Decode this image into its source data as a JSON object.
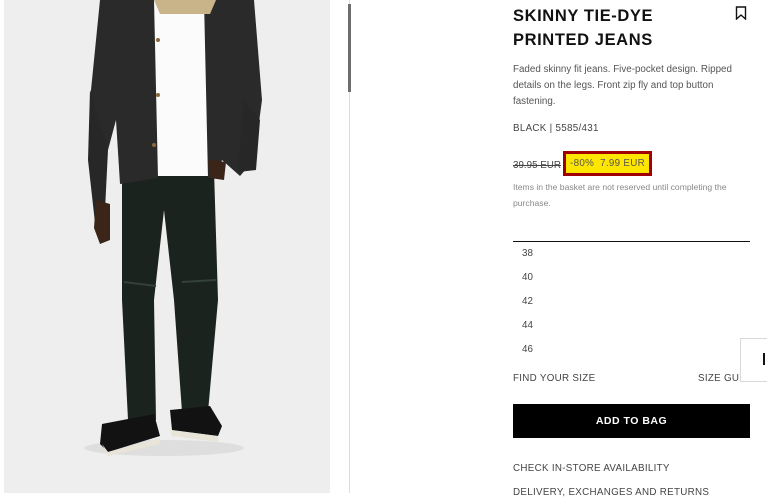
{
  "product": {
    "title": "SKINNY TIE-DYE PRINTED JEANS",
    "description": "Faded skinny fit jeans. Five-pocket design. Ripped details on the legs. Front zip fly and top button fastening.",
    "color": "BLACK",
    "separator": "|",
    "reference": "5585/431",
    "image_icon": "product-photo"
  },
  "pricing": {
    "old_price": "39.95 EUR",
    "discount": "-80%",
    "sale_price": "7.99 EUR",
    "highlight_color": "#ffe600",
    "highlight_border": "#a00000",
    "basket_note": "Items in the basket are not reserved until completing the purchase."
  },
  "sizes": [
    "38",
    "40",
    "42",
    "44",
    "46"
  ],
  "links": {
    "find_your_size": "FIND YOUR SIZE",
    "size_guide": "SIZE GUIDE",
    "check_store": "CHECK IN-STORE AVAILABILITY",
    "delivery": "DELIVERY, EXCHANGES AND RETURNS"
  },
  "actions": {
    "add_to_bag": "ADD TO BAG",
    "bookmark_icon": "bookmark-icon"
  }
}
